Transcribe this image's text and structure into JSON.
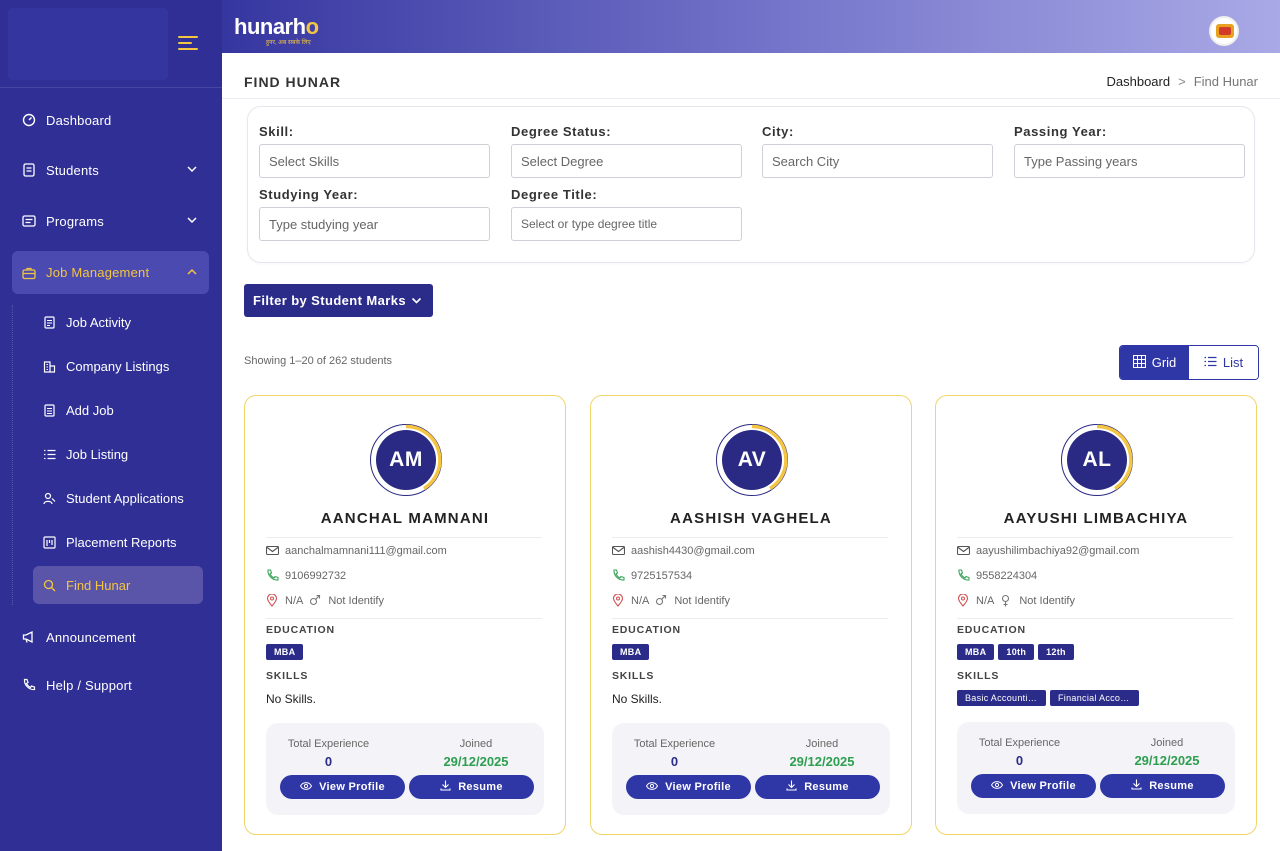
{
  "topbar": {
    "brand_main": "hunarh",
    "brand_accent": "o",
    "brand_tagline": "हुनर, अब सबके लिए"
  },
  "sidebar": {
    "items": [
      {
        "label": "Dashboard",
        "icon": "dashboard-icon"
      },
      {
        "label": "Students",
        "icon": "students-icon"
      },
      {
        "label": "Programs",
        "icon": "programs-icon"
      },
      {
        "label": "Job Management",
        "icon": "briefcase-icon"
      },
      {
        "label": "Announcement",
        "icon": "megaphone-icon"
      },
      {
        "label": "Help / Support",
        "icon": "phone-icon"
      }
    ],
    "subitems": [
      {
        "label": "Job Activity",
        "icon": "document-icon"
      },
      {
        "label": "Company Listings",
        "icon": "building-icon"
      },
      {
        "label": "Add Job",
        "icon": "add-document-icon"
      },
      {
        "label": "Job Listing",
        "icon": "list-icon"
      },
      {
        "label": "Student Applications",
        "icon": "users-icon"
      },
      {
        "label": "Placement Reports",
        "icon": "report-icon"
      },
      {
        "label": "Find Hunar",
        "icon": "search-icon"
      }
    ]
  },
  "header": {
    "title": "FIND HUNAR",
    "breadcrumb": [
      "Dashboard",
      ">",
      "Find Hunar"
    ]
  },
  "filters": {
    "skill": {
      "label": "Skill:",
      "placeholder": "Select Skills"
    },
    "degree_status": {
      "label": "Degree Status:",
      "placeholder": "Select Degree"
    },
    "city": {
      "label": "City:",
      "placeholder": "Search City"
    },
    "passing_year": {
      "label": "Passing Year:",
      "placeholder": "Type Passing years"
    },
    "studying_year": {
      "label": "Studying Year:",
      "placeholder": "Type studying year"
    },
    "degree_title": {
      "label": "Degree Title:",
      "placeholder": "Select or type degree title"
    }
  },
  "marks_button": "Filter by Student Marks",
  "showing": "Showing 1–20 of 262 students",
  "view_toggle": {
    "grid": "Grid",
    "list": "List"
  },
  "labels": {
    "education": "EDUCATION",
    "skills": "SKILLS",
    "total_experience": "Total Experience",
    "joined": "Joined",
    "view_profile": "View Profile",
    "resume": "Resume"
  },
  "students": [
    {
      "initials": "AM",
      "name": "AANCHAL MAMNANI",
      "email": "aanchalmamnani111@gmail.com",
      "phone": "9106992732",
      "location": "N/A",
      "gender": "Not Identify",
      "education": [
        "MBA"
      ],
      "skills": [],
      "no_skills": "No Skills.",
      "experience": "0",
      "joined": "29/12/2025"
    },
    {
      "initials": "AV",
      "name": "AASHISH VAGHELA",
      "email": "aashish4430@gmail.com",
      "phone": "9725157534",
      "location": "N/A",
      "gender": "Not Identify",
      "education": [
        "MBA"
      ],
      "skills": [],
      "no_skills": "No Skills.",
      "experience": "0",
      "joined": "29/12/2025"
    },
    {
      "initials": "AL",
      "name": "AAYUSHI LIMBACHIYA",
      "email": "aayushilimbachiya92@gmail.com",
      "phone": "9558224304",
      "location": "N/A",
      "gender": "Not Identify",
      "education": [
        "MBA",
        "10th",
        "12th"
      ],
      "skills": [
        "Basic Accounting",
        "Financial Accounting"
      ],
      "experience": "0",
      "joined": "29/12/2025"
    }
  ],
  "colors": {
    "sidebar_bg": "#2f2f96",
    "accent_yellow": "#f4c542",
    "primary": "#2f36a6",
    "joined_green": "#2e9e4f"
  }
}
